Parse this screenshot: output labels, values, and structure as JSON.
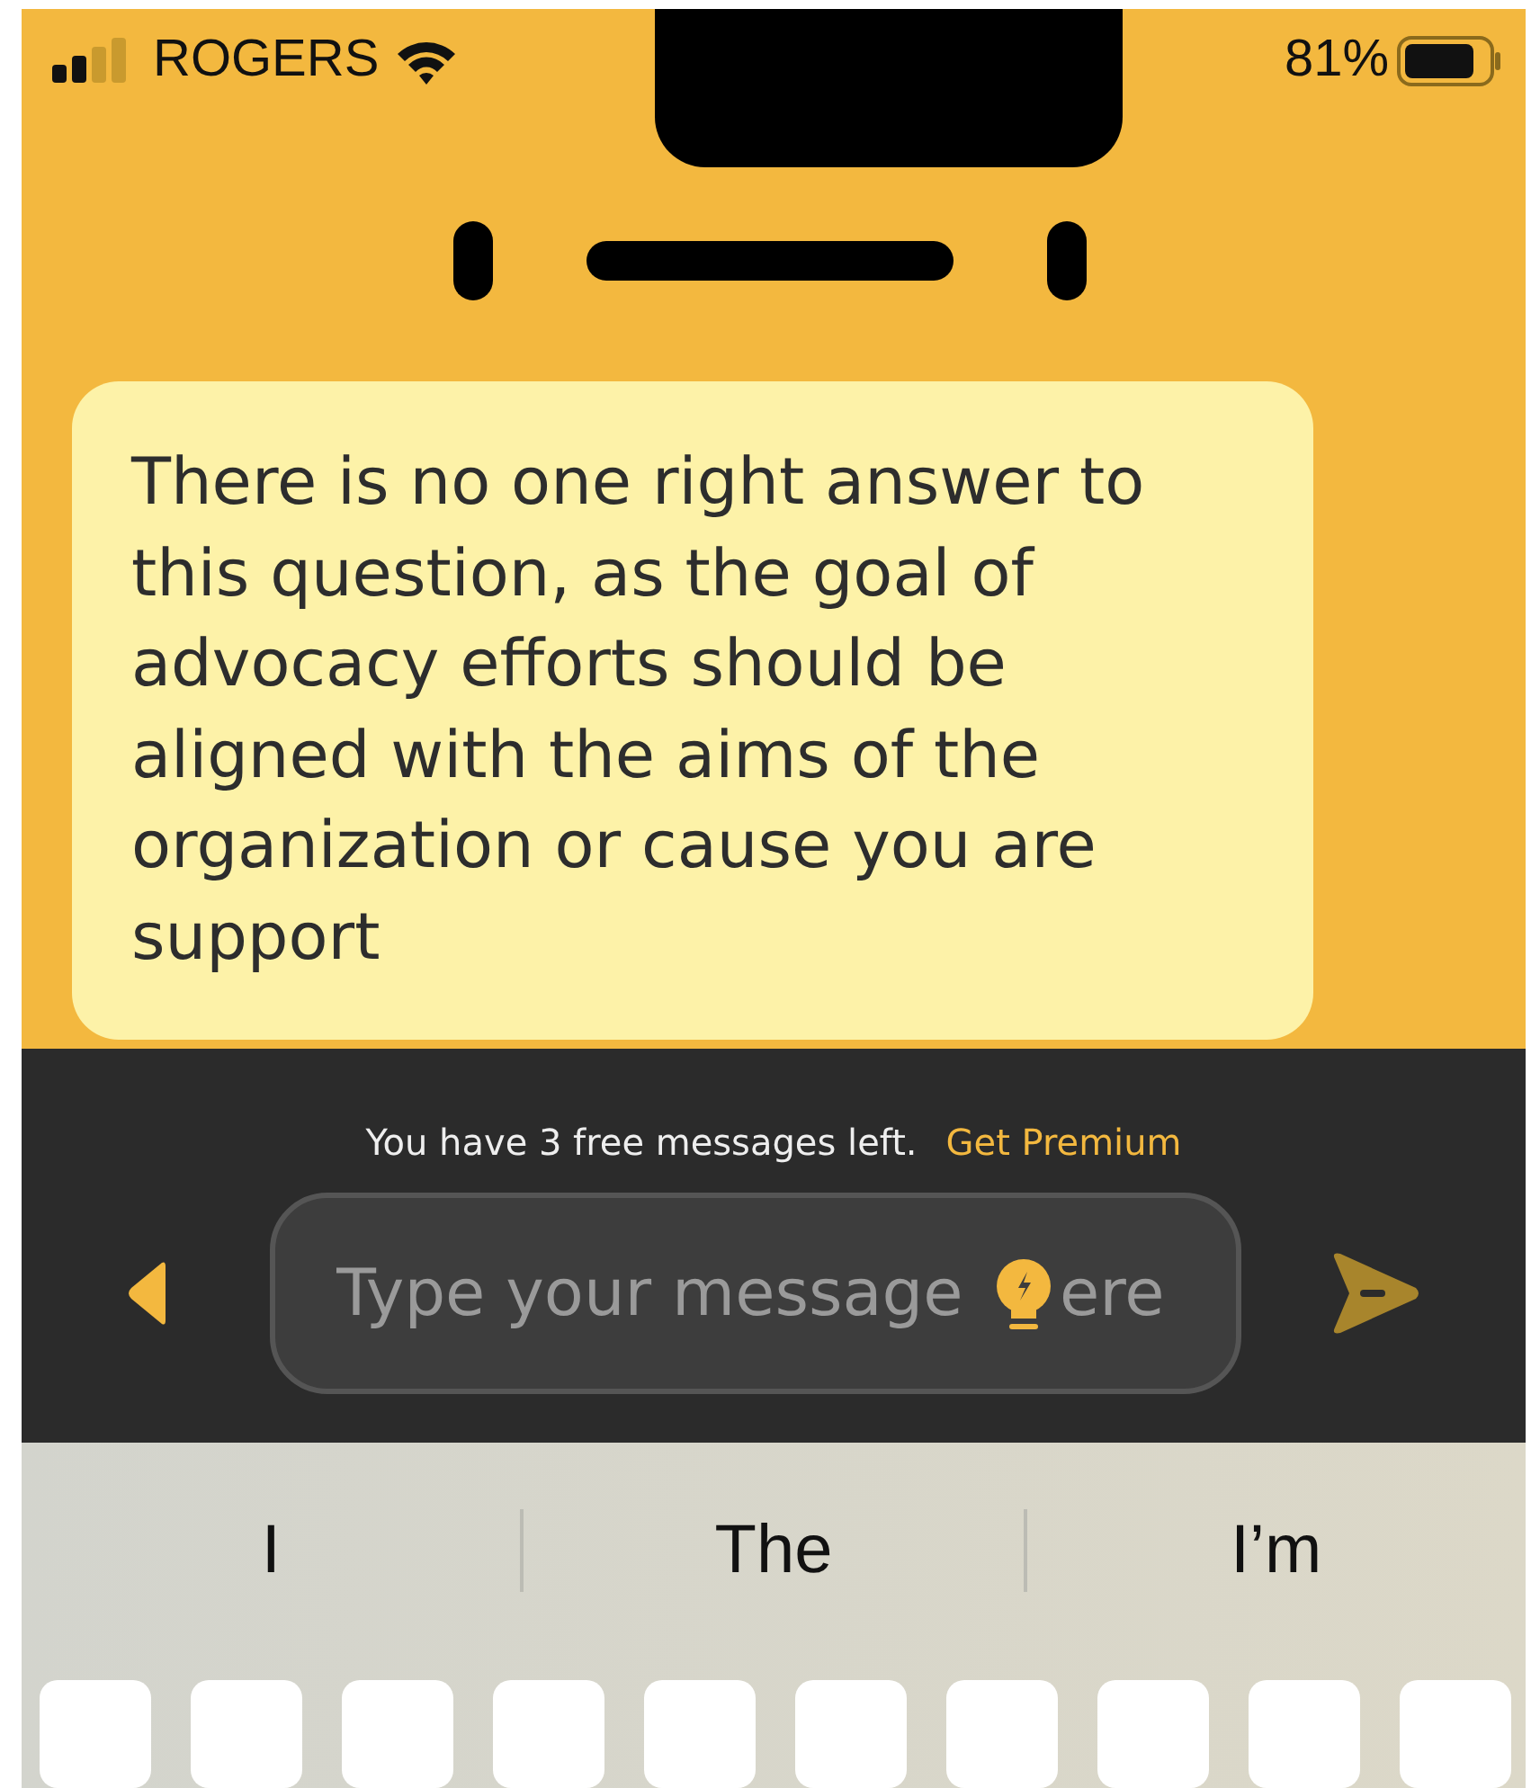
{
  "status_bar": {
    "carrier": "ROGERS",
    "battery": "81%"
  },
  "message": {
    "text": "There is no one right answer to this question, as the goal of advocacy efforts should be aligned with the aims of the organization or cause you are support"
  },
  "notice": {
    "text": "You have 3 free messages left.",
    "link": "Get Premium"
  },
  "composer": {
    "placeholder": "Type your message",
    "placeholder_rest": "ere"
  },
  "suggestions": [
    "I",
    "The",
    "I’m"
  ]
}
